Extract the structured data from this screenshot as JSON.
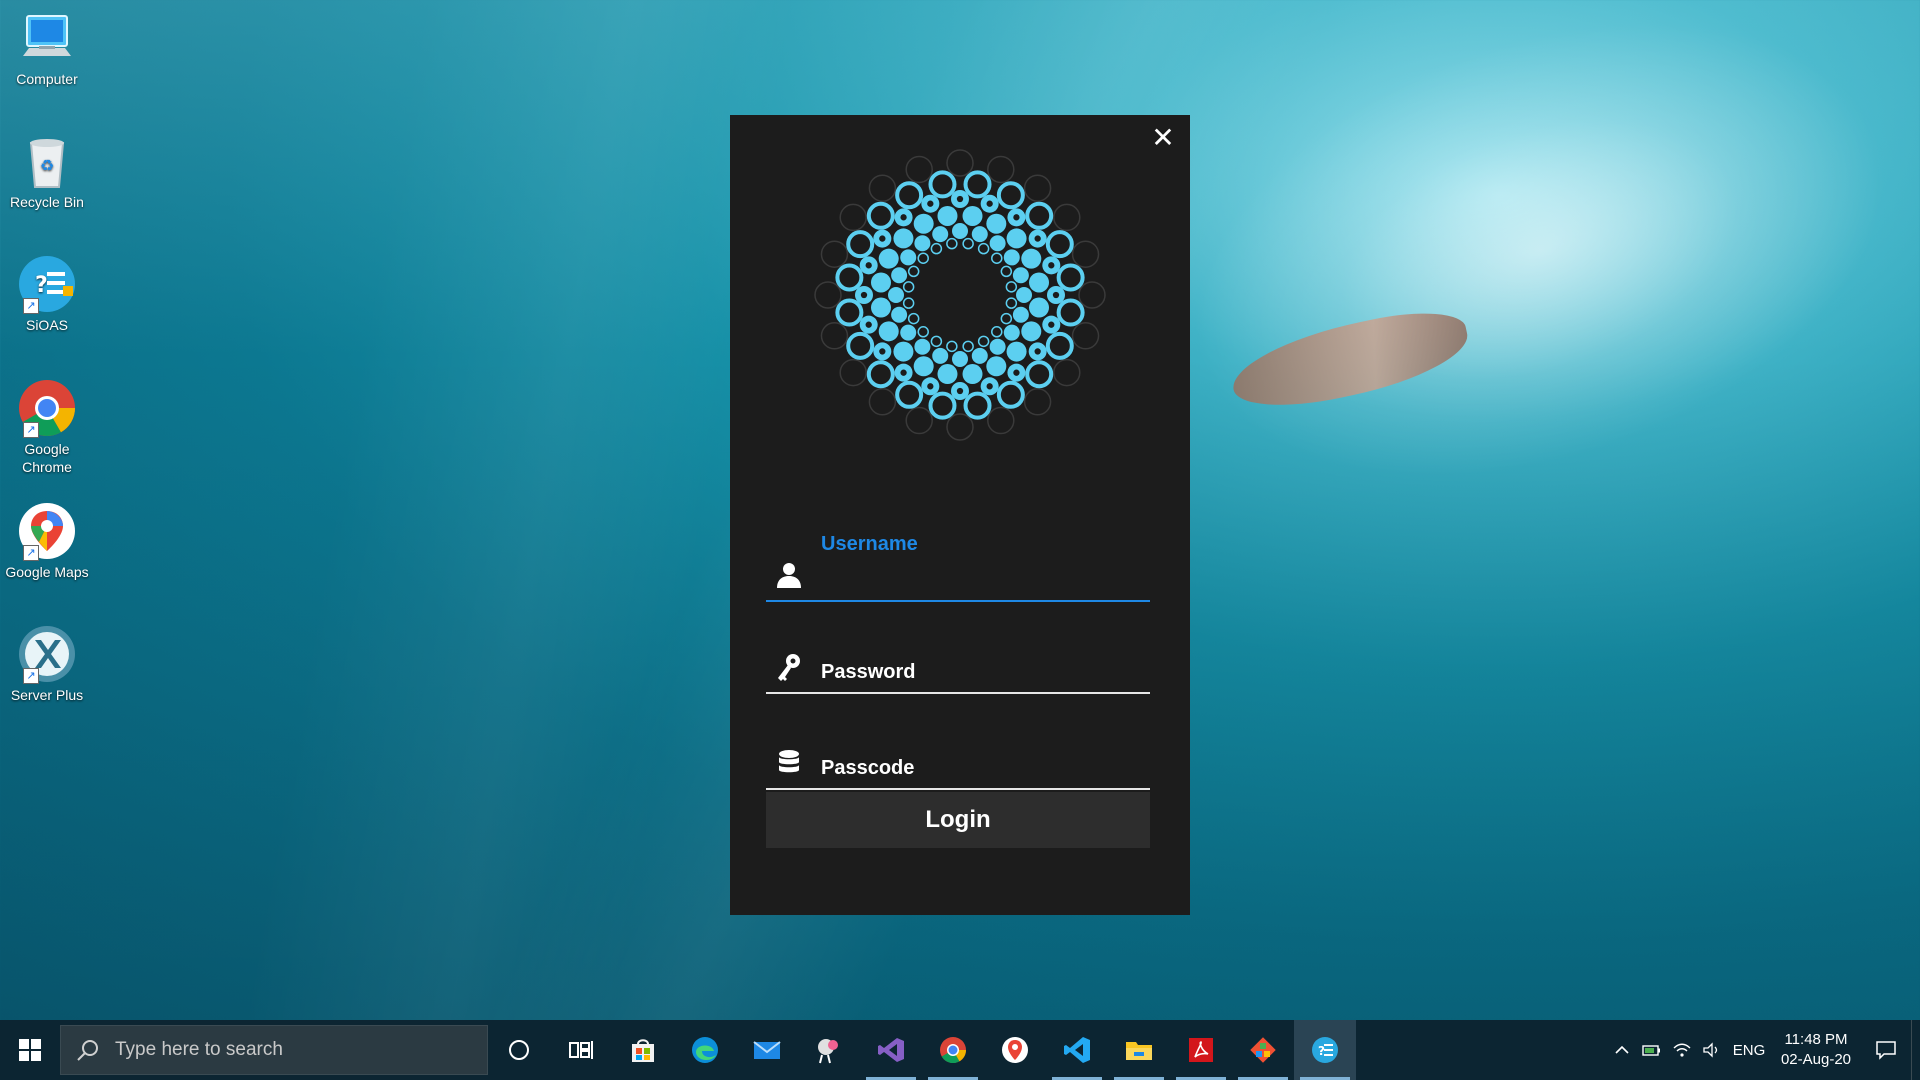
{
  "desktop": {
    "icons": [
      {
        "label": "Computer",
        "icon": "computer-icon"
      },
      {
        "label": "Recycle Bin",
        "icon": "recycle-bin-icon"
      },
      {
        "label": "SiOAS",
        "icon": "sioas-icon"
      },
      {
        "label": "Google Chrome",
        "icon": "chrome-icon"
      },
      {
        "label": "Google Maps",
        "icon": "google-maps-icon"
      },
      {
        "label": "Server Plus",
        "icon": "server-plus-icon"
      }
    ]
  },
  "login": {
    "close_label": "✕",
    "username_label": "Username",
    "password_label": "Password",
    "passcode_label": "Passcode",
    "login_label": "Login",
    "accent_color": "#1e88e5",
    "logo_color": "#5ccff0"
  },
  "taskbar": {
    "search_placeholder": "Type here to search",
    "apps": [
      "cortana-icon",
      "task-view-icon",
      "microsoft-store-icon",
      "edge-icon",
      "mail-icon",
      "snip-icon",
      "visual-studio-icon",
      "chrome-icon",
      "google-maps-icon",
      "vscode-icon",
      "file-explorer-icon",
      "acrobat-icon",
      "git-icon",
      "sioas-icon"
    ],
    "language": "ENG",
    "time": "11:48 PM",
    "date": "02-Aug-20"
  }
}
